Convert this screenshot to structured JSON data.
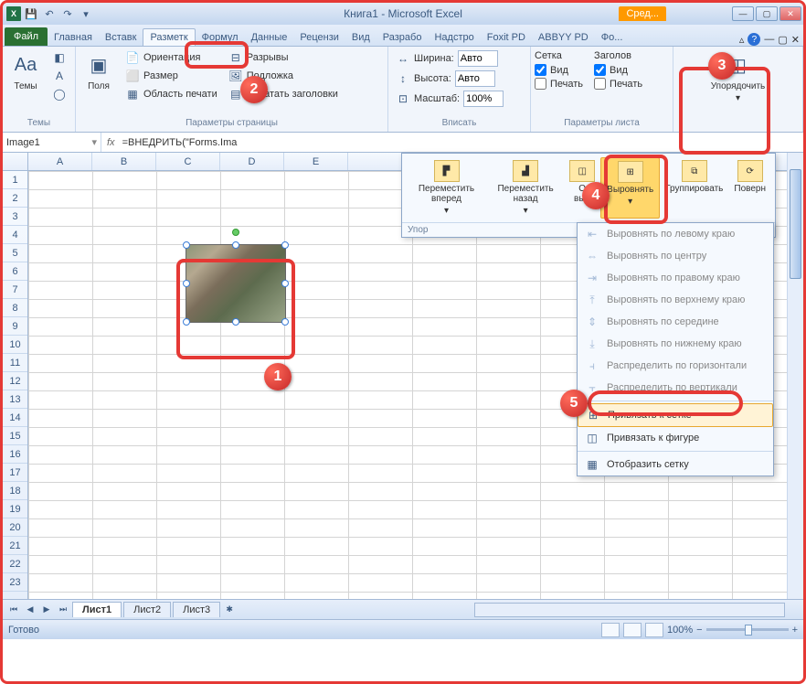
{
  "title": "Книга1 - Microsoft Excel",
  "context_tab": "Сред...",
  "qat": {
    "save": "💾",
    "undo": "↶",
    "redo": "↷"
  },
  "tabs": {
    "file": "Файл",
    "items": [
      "Главная",
      "Вставк",
      "Разметк",
      "Формул",
      "Данные",
      "Рецензи",
      "Вид",
      "Разрабо",
      "Надстро",
      "Foxit PD",
      "ABBYY PD",
      "Фо..."
    ]
  },
  "ribbon": {
    "themes": {
      "label": "Темы",
      "themes_btn": "Темы"
    },
    "page_setup": {
      "label": "Параметры страницы",
      "margins": "Поля",
      "orientation": "Ориентация",
      "size": "Размер",
      "print_area": "Область печати",
      "breaks": "Разрывы",
      "background": "Подложка",
      "print_titles": "Печатать заголовки"
    },
    "scale": {
      "label": "Вписать",
      "width_lbl": "Ширина:",
      "width_val": "Авто",
      "height_lbl": "Высота:",
      "height_val": "Авто",
      "scale_lbl": "Масштаб:",
      "scale_val": "100%"
    },
    "sheet_opts": {
      "label": "Параметры листа",
      "grid_lbl": "Сетка",
      "headings_lbl": "Заголов",
      "view": "Вид",
      "print": "Печать"
    },
    "arrange": {
      "label": "Упорядочить"
    }
  },
  "formula": {
    "name": "Image1",
    "fx": "fx",
    "value": "=ВНЕДРИТЬ(\"Forms.Ima"
  },
  "arrange_popup": {
    "bring_forward": "Переместить вперед",
    "send_backward": "Переместить назад",
    "selection_pane": "О выд",
    "align": "Выровнять",
    "group": "Группировать",
    "rotate": "Поверн",
    "footer": "Упор"
  },
  "align_menu": {
    "left": "Выровнять по левому краю",
    "center_h": "Выровнять по центру",
    "right": "Выровнять по правому краю",
    "top": "Выровнять по верхнему краю",
    "middle": "Выровнять по середине",
    "bottom": "Выровнять по нижнему краю",
    "dist_h": "Распределить по горизонтали",
    "dist_v": "Распределить по вертикали",
    "snap_grid": "Привязать к сетке",
    "snap_shape": "Привязать к фигуре",
    "view_grid": "Отобразить сетку"
  },
  "columns": [
    "A",
    "B",
    "C",
    "D",
    "E"
  ],
  "rows": [
    "1",
    "2",
    "3",
    "4",
    "5",
    "6",
    "7",
    "8",
    "9",
    "10",
    "11",
    "12",
    "13",
    "14",
    "15",
    "16",
    "17",
    "18",
    "19",
    "20",
    "21",
    "22",
    "23"
  ],
  "sheet_tabs": {
    "active": "Лист1",
    "others": [
      "Лист2",
      "Лист3"
    ]
  },
  "status": {
    "ready": "Готово",
    "zoom": "100%"
  },
  "callouts": {
    "n1": "1",
    "n2": "2",
    "n3": "3",
    "n4": "4",
    "n5": "5"
  }
}
